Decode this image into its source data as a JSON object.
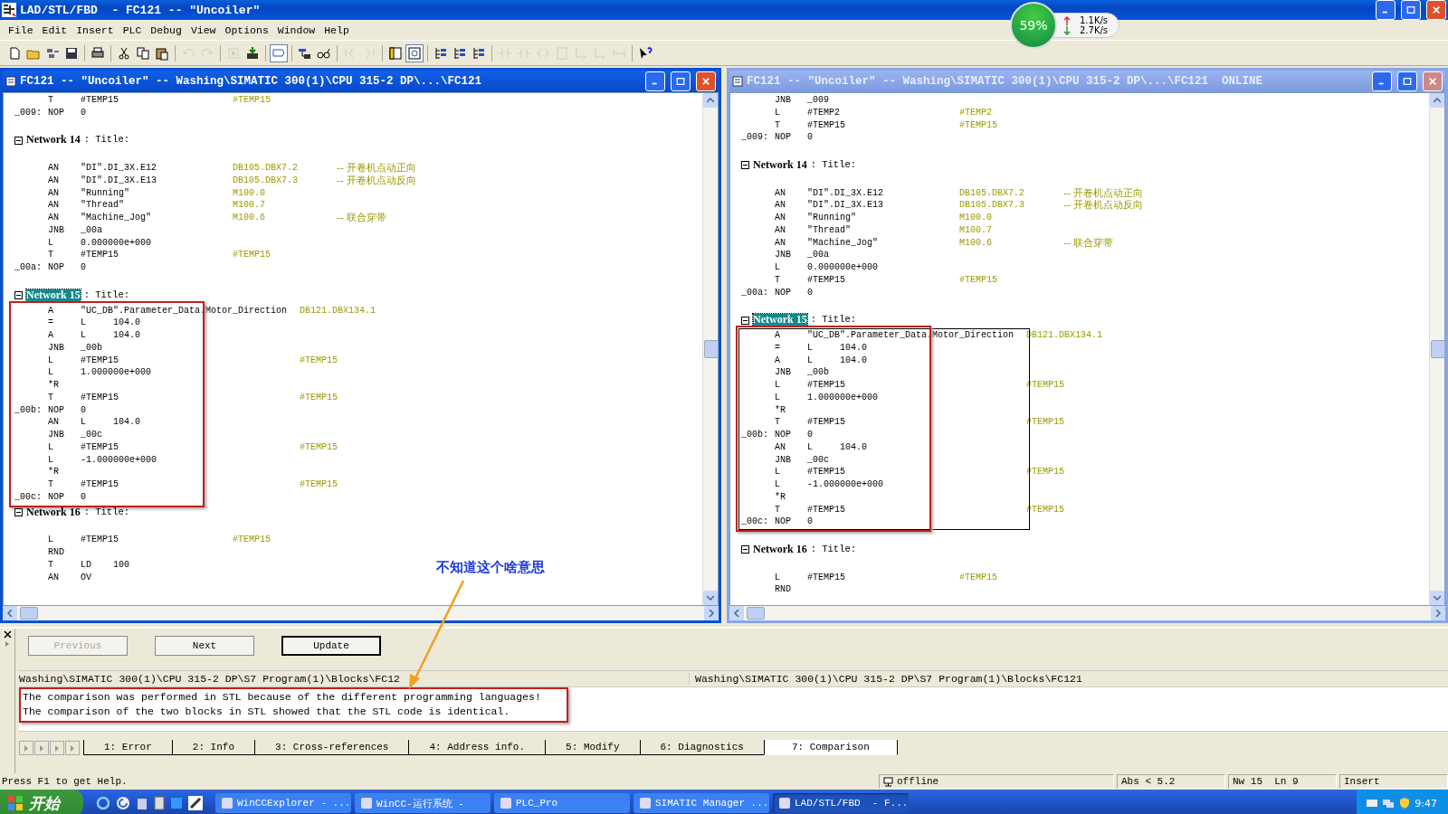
{
  "app_title": {
    "text": "LAD/STL/FBD  - FC121 -- \"Uncoiler\""
  },
  "net_meter": {
    "percent": "59%",
    "upload": "1.1K/s",
    "download": "2.7K/s"
  },
  "menu": [
    "File",
    "Edit",
    "Insert",
    "PLC",
    "Debug",
    "View",
    "Options",
    "Window",
    "Help"
  ],
  "toolbar": [
    [
      {
        "disabled": false,
        "pressed": false
      },
      {
        "disabled": false,
        "pressed": false
      },
      {
        "disabled": false,
        "pressed": false
      },
      {
        "disabled": false,
        "pressed": false
      }
    ],
    [
      {
        "disabled": false,
        "pressed": false
      }
    ],
    [
      {
        "disabled": false,
        "pressed": false
      },
      {
        "disabled": false,
        "pressed": false
      },
      {
        "disabled": false,
        "pressed": false
      }
    ],
    [
      {
        "disabled": true,
        "pressed": false
      },
      {
        "disabled": true,
        "pressed": false
      }
    ],
    [
      {
        "disabled": true,
        "pressed": false
      },
      {
        "disabled": false,
        "pressed": false
      }
    ],
    [
      {
        "disabled": false,
        "pressed": true
      }
    ],
    [
      {
        "disabled": false,
        "pressed": false
      },
      {
        "disabled": false,
        "pressed": false
      }
    ],
    [
      {
        "disabled": true,
        "pressed": false
      },
      {
        "disabled": true,
        "pressed": false
      }
    ],
    [
      {
        "disabled": false,
        "pressed": false
      },
      {
        "disabled": false,
        "pressed": true
      }
    ],
    [
      {
        "disabled": false,
        "pressed": false
      },
      {
        "disabled": false,
        "pressed": false
      },
      {
        "disabled": false,
        "pressed": false
      }
    ],
    [
      {
        "disabled": true,
        "pressed": false
      },
      {
        "disabled": true,
        "pressed": false
      },
      {
        "disabled": true,
        "pressed": false
      },
      {
        "disabled": true,
        "pressed": false
      },
      {
        "disabled": true,
        "pressed": false
      },
      {
        "disabled": true,
        "pressed": false
      },
      {
        "disabled": true,
        "pressed": false
      }
    ],
    [
      {
        "disabled": false,
        "pressed": false
      }
    ]
  ],
  "panes": [
    {
      "title": "FC121 -- \"Uncoiler\" -- Washing\\SIMATIC 300(1)\\CPU 315-2 DP\\...\\FC121",
      "active": true,
      "sections": [
        {
          "boxed": false,
          "framed": false,
          "lines": [
            {
              "kind": "stmt",
              "op": "T",
              "operand": "#TEMP15",
              "address": "#TEMP15"
            },
            {
              "kind": "stmt",
              "label": "_009:",
              "op": "NOP",
              "operand": "0"
            },
            {
              "kind": "blank"
            },
            {
              "kind": "network",
              "name": "Network 14",
              "title": ": Title:",
              "selected": false
            },
            {
              "kind": "blank"
            },
            {
              "kind": "stmt",
              "op": "AN",
              "operand": "\"DI\".DI_3X.E12",
              "address": "DB105.DBX7.2",
              "comment": "-- 开卷机点动正向"
            },
            {
              "kind": "stmt",
              "op": "AN",
              "operand": "\"DI\".DI_3X.E13",
              "address": "DB105.DBX7.3",
              "comment": "-- 开卷机点动反向"
            },
            {
              "kind": "stmt",
              "op": "AN",
              "operand": "\"Running\"",
              "address": "M100.0"
            },
            {
              "kind": "stmt",
              "op": "AN",
              "operand": "\"Thread\"",
              "address": "M100.7"
            },
            {
              "kind": "stmt",
              "op": "AN",
              "operand": "\"Machine_Jog\"",
              "address": "M100.6",
              "comment": "-- 联合穿带"
            },
            {
              "kind": "stmt",
              "op": "JNB",
              "operand": "_00a"
            },
            {
              "kind": "stmt",
              "op": "L",
              "operand": "0.000000e+000"
            },
            {
              "kind": "stmt",
              "op": "T",
              "operand": "#TEMP15",
              "address": "#TEMP15"
            },
            {
              "kind": "stmt",
              "label": "_00a:",
              "op": "NOP",
              "operand": "0"
            },
            {
              "kind": "blank"
            },
            {
              "kind": "network",
              "name": "Network 15",
              "title": ": Title:",
              "selected": true
            }
          ]
        },
        {
          "boxed": true,
          "framed": false,
          "lines": [
            {
              "kind": "stmt",
              "op": "A",
              "operand": "\"UC_DB\".Parameter_Data.Motor_Direction",
              "address": "DB121.DBX134.1"
            },
            {
              "kind": "stmt",
              "op": "=",
              "operand": "L     104.0"
            },
            {
              "kind": "stmt",
              "op": "A",
              "operand": "L     104.0"
            },
            {
              "kind": "stmt",
              "op": "JNB",
              "operand": "_00b"
            },
            {
              "kind": "stmt",
              "op": "L",
              "operand": "#TEMP15",
              "address": "#TEMP15"
            },
            {
              "kind": "stmt",
              "op": "L",
              "operand": "1.000000e+000"
            },
            {
              "kind": "stmt",
              "op": "*R"
            },
            {
              "kind": "stmt",
              "op": "T",
              "operand": "#TEMP15",
              "address": "#TEMP15"
            },
            {
              "kind": "stmt",
              "label": "_00b:",
              "op": "NOP",
              "operand": "0"
            },
            {
              "kind": "stmt",
              "op": "AN",
              "operand": "L     104.0"
            },
            {
              "kind": "stmt",
              "op": "JNB",
              "operand": "_00c"
            },
            {
              "kind": "stmt",
              "op": "L",
              "operand": "#TEMP15",
              "address": "#TEMP15"
            },
            {
              "kind": "stmt",
              "op": "L",
              "operand": "-1.000000e+000"
            },
            {
              "kind": "stmt",
              "op": "*R"
            },
            {
              "kind": "stmt",
              "op": "T",
              "operand": "#TEMP15",
              "address": "#TEMP15"
            },
            {
              "kind": "stmt",
              "label": "_00c:",
              "op": "NOP",
              "operand": "0"
            }
          ]
        },
        {
          "boxed": false,
          "framed": false,
          "lines": [
            {
              "kind": "network",
              "name": "Network 16",
              "title": ": Title:",
              "selected": false
            },
            {
              "kind": "blank"
            },
            {
              "kind": "stmt",
              "op": "L",
              "operand": "#TEMP15",
              "address": "#TEMP15"
            },
            {
              "kind": "stmt",
              "op": "RND"
            },
            {
              "kind": "stmt",
              "op": "T",
              "operand": "LD    100"
            },
            {
              "kind": "stmt",
              "op": "AN",
              "operand": "OV"
            }
          ]
        }
      ]
    },
    {
      "title": "FC121 -- \"Uncoiler\" -- Washing\\SIMATIC 300(1)\\CPU 315-2 DP\\...\\FC121  ONLINE",
      "active": false,
      "sections": [
        {
          "boxed": false,
          "framed": false,
          "lines": [
            {
              "kind": "stmt",
              "op": "JNB",
              "operand": "_009"
            },
            {
              "kind": "stmt",
              "op": "L",
              "operand": "#TEMP2",
              "address": "#TEMP2"
            },
            {
              "kind": "stmt",
              "op": "T",
              "operand": "#TEMP15",
              "address": "#TEMP15"
            },
            {
              "kind": "stmt",
              "label": "_009:",
              "op": "NOP",
              "operand": "0"
            },
            {
              "kind": "blank"
            },
            {
              "kind": "network",
              "name": "Network 14",
              "title": ": Title:",
              "selected": false
            },
            {
              "kind": "blank"
            },
            {
              "kind": "stmt",
              "op": "AN",
              "operand": "\"DI\".DI_3X.E12",
              "address": "DB105.DBX7.2",
              "comment": "-- 开卷机点动正向"
            },
            {
              "kind": "stmt",
              "op": "AN",
              "operand": "\"DI\".DI_3X.E13",
              "address": "DB105.DBX7.3",
              "comment": "-- 开卷机点动反向"
            },
            {
              "kind": "stmt",
              "op": "AN",
              "operand": "\"Running\"",
              "address": "M100.0"
            },
            {
              "kind": "stmt",
              "op": "AN",
              "operand": "\"Thread\"",
              "address": "M100.7"
            },
            {
              "kind": "stmt",
              "op": "AN",
              "operand": "\"Machine_Jog\"",
              "address": "M100.6",
              "comment": "-- 联合穿带"
            },
            {
              "kind": "stmt",
              "op": "JNB",
              "operand": "_00a"
            },
            {
              "kind": "stmt",
              "op": "L",
              "operand": "0.000000e+000"
            },
            {
              "kind": "stmt",
              "op": "T",
              "operand": "#TEMP15",
              "address": "#TEMP15"
            },
            {
              "kind": "stmt",
              "label": "_00a:",
              "op": "NOP",
              "operand": "0"
            },
            {
              "kind": "blank"
            },
            {
              "kind": "network",
              "name": "Network 15",
              "title": ": Title:",
              "selected": true
            }
          ]
        },
        {
          "boxed": true,
          "framed": true,
          "lines": [
            {
              "kind": "stmt",
              "op": "A",
              "operand": "\"UC_DB\".Parameter_Data.Motor_Direction",
              "address": "DB121.DBX134.1"
            },
            {
              "kind": "stmt",
              "op": "=",
              "operand": "L     104.0"
            },
            {
              "kind": "stmt",
              "op": "A",
              "operand": "L     104.0"
            },
            {
              "kind": "stmt",
              "op": "JNB",
              "operand": "_00b"
            },
            {
              "kind": "stmt",
              "op": "L",
              "operand": "#TEMP15",
              "address": "#TEMP15"
            },
            {
              "kind": "stmt",
              "op": "L",
              "operand": "1.000000e+000"
            },
            {
              "kind": "stmt",
              "op": "*R"
            },
            {
              "kind": "stmt",
              "op": "T",
              "operand": "#TEMP15",
              "address": "#TEMP15"
            },
            {
              "kind": "stmt",
              "label": "_00b:",
              "op": "NOP",
              "operand": "0"
            },
            {
              "kind": "stmt",
              "op": "AN",
              "operand": "L     104.0"
            },
            {
              "kind": "stmt",
              "op": "JNB",
              "operand": "_00c"
            },
            {
              "kind": "stmt",
              "op": "L",
              "operand": "#TEMP15",
              "address": "#TEMP15"
            },
            {
              "kind": "stmt",
              "op": "L",
              "operand": "-1.000000e+000"
            },
            {
              "kind": "stmt",
              "op": "*R"
            },
            {
              "kind": "stmt",
              "op": "T",
              "operand": "#TEMP15",
              "address": "#TEMP15"
            },
            {
              "kind": "stmt",
              "label": "_00c:",
              "op": "NOP",
              "operand": "0"
            }
          ]
        },
        {
          "boxed": false,
          "framed": false,
          "lines": [
            {
              "kind": "blank"
            },
            {
              "kind": "network",
              "name": "Network 16",
              "title": ": Title:",
              "selected": false
            },
            {
              "kind": "blank"
            },
            {
              "kind": "stmt",
              "op": "L",
              "operand": "#TEMP15",
              "address": "#TEMP15"
            },
            {
              "kind": "stmt",
              "op": "RND"
            }
          ]
        }
      ]
    }
  ],
  "annotation": {
    "text": "不知道这个啥意思"
  },
  "details": {
    "buttons": [
      {
        "label": "Previous",
        "disabled": true,
        "focused": false
      },
      {
        "label": "Next",
        "disabled": false,
        "focused": false
      },
      {
        "label": "Update",
        "disabled": false,
        "focused": true
      }
    ],
    "paths": [
      "Washing\\SIMATIC 300(1)\\CPU 315-2 DP\\S7 Program(1)\\Blocks\\FC12",
      "Washing\\SIMATIC 300(1)\\CPU 315-2 DP\\S7 Program(1)\\Blocks\\FC121"
    ],
    "messages": {
      "boxed": true,
      "lines": [
        "The comparison was performed in STL because of the different programming languages!",
        "The comparison of the two blocks in STL showed that the STL code is identical."
      ]
    },
    "tabs": [
      {
        "label": "1: Error",
        "selected": false
      },
      {
        "label": "2: Info",
        "selected": false
      },
      {
        "label": "3: Cross-references",
        "selected": false
      },
      {
        "label": "4: Address info.",
        "selected": false
      },
      {
        "label": "5: Modify",
        "selected": false
      },
      {
        "label": "6: Diagnostics",
        "selected": false
      },
      {
        "label": "7: Comparison",
        "selected": true
      }
    ]
  },
  "status_bar": {
    "help": "Press F1 to get Help.",
    "fields": [
      {
        "kind": "connection",
        "text": "offline"
      },
      {
        "kind": "plain",
        "text": "Abs < 5.2"
      },
      {
        "kind": "plain",
        "text": "Nw 15  Ln 9"
      },
      {
        "kind": "plain",
        "text": "Insert"
      }
    ]
  },
  "taskbar": {
    "start": "开始",
    "tasks": [
      {
        "label": "WinCCExplorer - ...",
        "selected": false
      },
      {
        "label": "WinCC-运行系统 - ",
        "selected": false
      },
      {
        "label": "PLC_Pro",
        "selected": false
      },
      {
        "label": "SIMATIC Manager ...",
        "selected": false
      },
      {
        "label": "LAD/STL/FBD  - F...",
        "selected": true
      }
    ],
    "clock": "9:47"
  }
}
